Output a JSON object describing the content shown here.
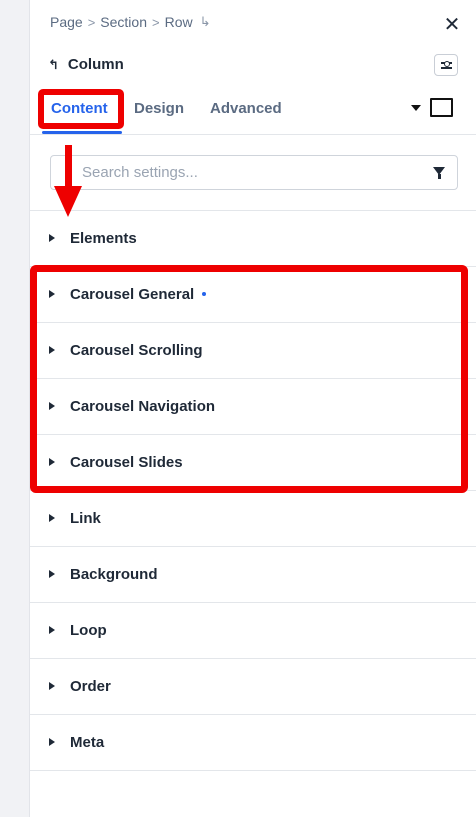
{
  "breadcrumb": {
    "items": [
      "Page",
      "Section",
      "Row"
    ],
    "separator": ">",
    "enter_symbol": "↳"
  },
  "close_symbol": "✕",
  "element": {
    "back_symbol": "↰",
    "title": "Column"
  },
  "tabs": [
    {
      "label": "Content",
      "active": true
    },
    {
      "label": "Design",
      "active": false
    },
    {
      "label": "Advanced",
      "active": false
    }
  ],
  "search": {
    "placeholder": "Search settings...",
    "value": ""
  },
  "sections": [
    {
      "label": "Elements",
      "modified": false
    },
    {
      "label": "Carousel General",
      "modified": true
    },
    {
      "label": "Carousel Scrolling",
      "modified": false
    },
    {
      "label": "Carousel Navigation",
      "modified": false
    },
    {
      "label": "Carousel Slides",
      "modified": false
    },
    {
      "label": "Link",
      "modified": false
    },
    {
      "label": "Background",
      "modified": false
    },
    {
      "label": "Loop",
      "modified": false
    },
    {
      "label": "Order",
      "modified": false
    },
    {
      "label": "Meta",
      "modified": false
    }
  ],
  "colors": {
    "accent": "#2563eb",
    "annotation": "#ee0000",
    "text": "#1f2937",
    "muted": "#5b6b82"
  },
  "icons": {
    "close": "close-icon",
    "back": "back-arrow-icon",
    "settings_toggle": "sliders-icon",
    "dropdown": "caret-down-icon",
    "device": "desktop-icon",
    "filter": "filter-icon",
    "section_caret": "caret-right-icon"
  }
}
